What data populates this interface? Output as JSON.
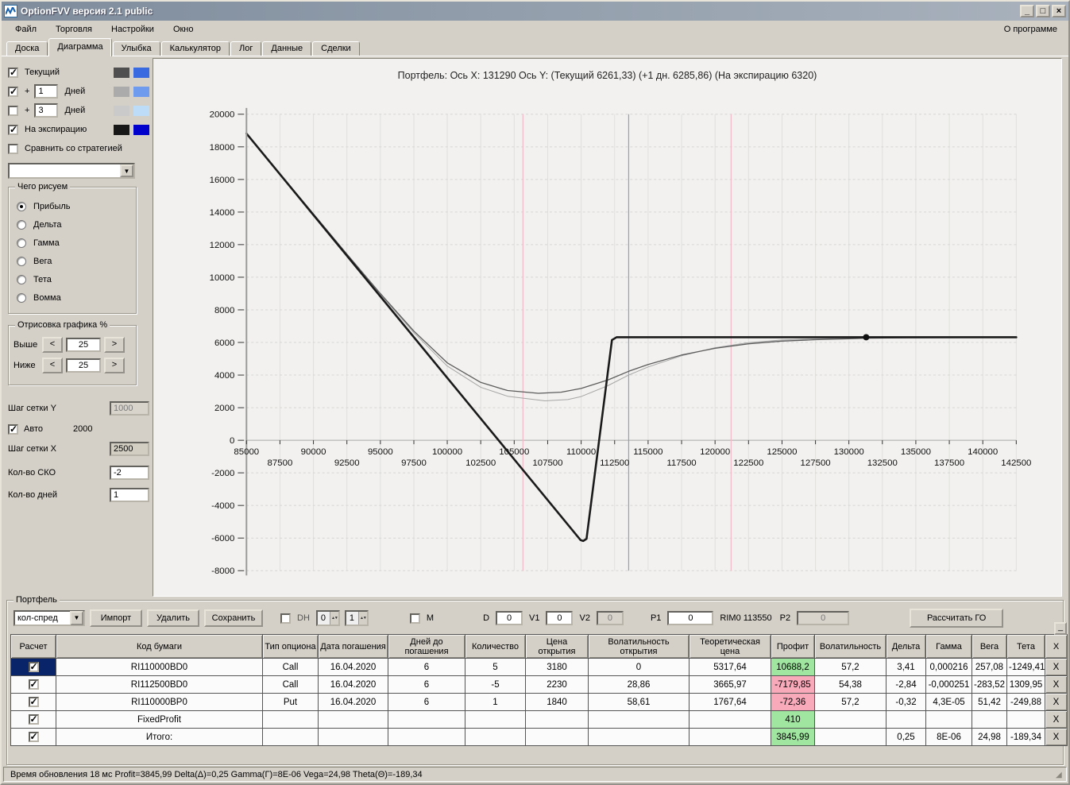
{
  "window": {
    "title": "OptionFVV версия 2.1 public",
    "buttons": {
      "minimize": "_",
      "maximize": "□",
      "close": "×"
    }
  },
  "menu": {
    "items": [
      "Файл",
      "Торговля",
      "Настройки",
      "Окно"
    ],
    "about": "О программе"
  },
  "tabs": {
    "items": [
      "Доска",
      "Диаграмма",
      "Улыбка",
      "Калькулятор",
      "Лог",
      "Данные",
      "Сделки"
    ],
    "active": "Диаграмма"
  },
  "sidebar": {
    "legend": [
      {
        "label": "Текущий",
        "checked": true,
        "color_a": "#4f4f4f",
        "color_b": "#3a6ae0"
      },
      {
        "plus": "+",
        "value": "1",
        "label": "Дней",
        "checked": true,
        "color_a": "#ababab",
        "color_b": "#6f9bee"
      },
      {
        "plus": "+",
        "value": "3",
        "label": "Дней",
        "checked": false,
        "color_a": "#cacaca",
        "color_b": "#bddcf8"
      },
      {
        "label": "На экспирацию",
        "checked": true,
        "color_a": "#181818",
        "color_b": "#0000cc"
      }
    ],
    "compare": {
      "label": "Сравнить со стратегией",
      "checked": false,
      "dropdown_value": ""
    },
    "draw_group": {
      "title": "Чего рисуем",
      "options": [
        "Прибыль",
        "Дельта",
        "Гамма",
        "Вега",
        "Тета",
        "Вомма"
      ],
      "selected": "Прибыль"
    },
    "render_group": {
      "title": "Отрисовка графика %",
      "above_label": "Выше",
      "above_value": "25",
      "below_label": "Ниже",
      "below_value": "25",
      "dec": "<",
      "inc": ">"
    },
    "grid_y_label": "Шаг сетки Y",
    "grid_y_value": "1000",
    "auto_label": "Авто",
    "auto_checked": true,
    "auto_value": "2000",
    "grid_x_label": "Шаг сетки X",
    "grid_x_value": "2500",
    "sko_label": "Кол-во СКО",
    "sko_value": "-2",
    "days_label": "Кол-во дней",
    "days_value": "1"
  },
  "chart": {
    "title": "Портфель: Ось X: 131290 Ось Y:  (Текущий 6261,33)  (+1 дн. 6285,86)  (На экспирацию 6320)"
  },
  "chart_data": {
    "type": "line",
    "title": "Портфель: Ось X: 131290 Ось Y: (Текущий 6261,33) (+1 дн. 6285,86) (На экспирацию 6320)",
    "x_axis": {
      "min": 85000,
      "max": 142500,
      "step": 2500
    },
    "y_axis": {
      "min": -8000,
      "max": 20000,
      "step": 2000
    },
    "grid": {
      "v_color": "#e0dfdd",
      "h_color": "#d7d6d4"
    },
    "series": [
      {
        "name": "На экспирацию",
        "color": "#1a1a1a",
        "width": 2.6,
        "points": [
          [
            85000,
            18820
          ],
          [
            109950,
            -6120
          ],
          [
            110150,
            -6180
          ],
          [
            110400,
            -6050
          ],
          [
            112300,
            6150
          ],
          [
            112650,
            6320
          ],
          [
            142500,
            6320
          ]
        ]
      },
      {
        "name": "Текущий",
        "color": "#5d5d5d",
        "width": 1.3,
        "points": [
          [
            85000,
            18820
          ],
          [
            92500,
            11420
          ],
          [
            95000,
            9000
          ],
          [
            97500,
            6700
          ],
          [
            100000,
            4750
          ],
          [
            102500,
            3550
          ],
          [
            104500,
            3050
          ],
          [
            106800,
            2880
          ],
          [
            108500,
            2950
          ],
          [
            110000,
            3180
          ],
          [
            112000,
            3700
          ],
          [
            113550,
            4230
          ],
          [
            115000,
            4650
          ],
          [
            117500,
            5230
          ],
          [
            120000,
            5640
          ],
          [
            122500,
            5920
          ],
          [
            125000,
            6080
          ],
          [
            127500,
            6170
          ],
          [
            130000,
            6230
          ],
          [
            131290,
            6261
          ],
          [
            135000,
            6290
          ],
          [
            142500,
            6315
          ]
        ]
      },
      {
        "name": "+1 день",
        "color": "#a6a6a6",
        "width": 1,
        "points": [
          [
            85000,
            18820
          ],
          [
            92500,
            11400
          ],
          [
            95000,
            8950
          ],
          [
            97500,
            6600
          ],
          [
            100000,
            4550
          ],
          [
            102500,
            3250
          ],
          [
            104500,
            2700
          ],
          [
            107300,
            2420
          ],
          [
            109000,
            2500
          ],
          [
            110000,
            2680
          ],
          [
            112000,
            3350
          ],
          [
            113550,
            4000
          ],
          [
            115000,
            4500
          ],
          [
            117500,
            5180
          ],
          [
            120000,
            5680
          ],
          [
            122500,
            5990
          ],
          [
            125000,
            6150
          ],
          [
            127500,
            6230
          ],
          [
            130000,
            6272
          ],
          [
            131290,
            6286
          ],
          [
            135000,
            6305
          ],
          [
            142500,
            6318
          ]
        ]
      }
    ],
    "vlines": [
      {
        "x": 105650,
        "color": "#f2b9c6"
      },
      {
        "x": 113550,
        "color": "#8fa3b5"
      },
      {
        "x": 121200,
        "color": "#f2b9c6"
      }
    ],
    "marker": {
      "x": 131290,
      "y": 6320,
      "color": "#111111"
    }
  },
  "portfolio": {
    "group_title": "Портфель",
    "toolbar": {
      "preset": "кол-спред",
      "import": "Импорт",
      "delete": "Удалить",
      "save": "Сохранить",
      "dh_label": "DH",
      "spin1": "0",
      "spin2": "1",
      "m_label": "M",
      "d_label": "D",
      "d_value": "0",
      "v1_label": "V1",
      "v1_value": "0",
      "v2_label": "V2",
      "v2_value": "0",
      "p1_label": "P1",
      "p1_value": "0",
      "instrument": "RIM0 113550",
      "p2_label": "P2",
      "p2_value": "0",
      "calc_button": "Рассчитать ГО",
      "collapse": "_"
    },
    "table": {
      "headers": [
        "Расчет",
        "Код бумаги",
        "Тип опциона",
        "Дата погашения",
        "Дней до погашения",
        "Количество",
        "Цена открытия",
        "Волатильность открытия",
        "Теоретическая цена",
        "Профит",
        "Волатильность",
        "Дельта",
        "Гамма",
        "Вега",
        "Тета",
        "X"
      ],
      "delete_label": "X",
      "rows": [
        {
          "checked": true,
          "selected": true,
          "cells": [
            "RI110000BD0",
            "Call",
            "16.04.2020",
            "6",
            "5",
            "3180",
            "0",
            "5317,64",
            {
              "t": "10688,2",
              "c": "pos"
            },
            "57,2",
            "3,41",
            "0,000216",
            "257,08",
            "-1249,41"
          ]
        },
        {
          "checked": true,
          "selected": false,
          "cells": [
            "RI112500BD0",
            "Call",
            "16.04.2020",
            "6",
            "-5",
            "2230",
            "28,86",
            "3665,97",
            {
              "t": "-7179,85",
              "c": "neg"
            },
            "54,38",
            "-2,84",
            "-0,000251",
            "-283,52",
            "1309,95"
          ]
        },
        {
          "checked": true,
          "selected": false,
          "cells": [
            "RI110000BP0",
            "Put",
            "16.04.2020",
            "6",
            "1",
            "1840",
            "58,61",
            "1767,64",
            {
              "t": "-72,36",
              "c": "neg"
            },
            "57,2",
            "-0,32",
            "4,3E-05",
            "51,42",
            "-249,88"
          ]
        },
        {
          "checked": true,
          "selected": false,
          "cells": [
            "FixedProfit",
            "",
            "",
            "",
            "",
            "",
            "",
            "",
            {
              "t": "410",
              "c": "pos"
            },
            "",
            "",
            "",
            "",
            ""
          ]
        },
        {
          "checked": true,
          "selected": false,
          "cells": [
            "Итого:",
            "",
            "",
            "",
            "",
            "",
            "",
            "",
            {
              "t": "3845,99",
              "c": "pos"
            },
            "",
            "0,25",
            "8E-06",
            "24,98",
            "-189,34"
          ]
        }
      ]
    }
  },
  "statusbar": {
    "text": "Время обновления 18 мс  Profit=3845,99 Delta(Δ)=0,25 Gamma(Γ)=8E-06 Vega=24,98 Theta(Θ)=-189,34",
    "grip": "◢"
  }
}
